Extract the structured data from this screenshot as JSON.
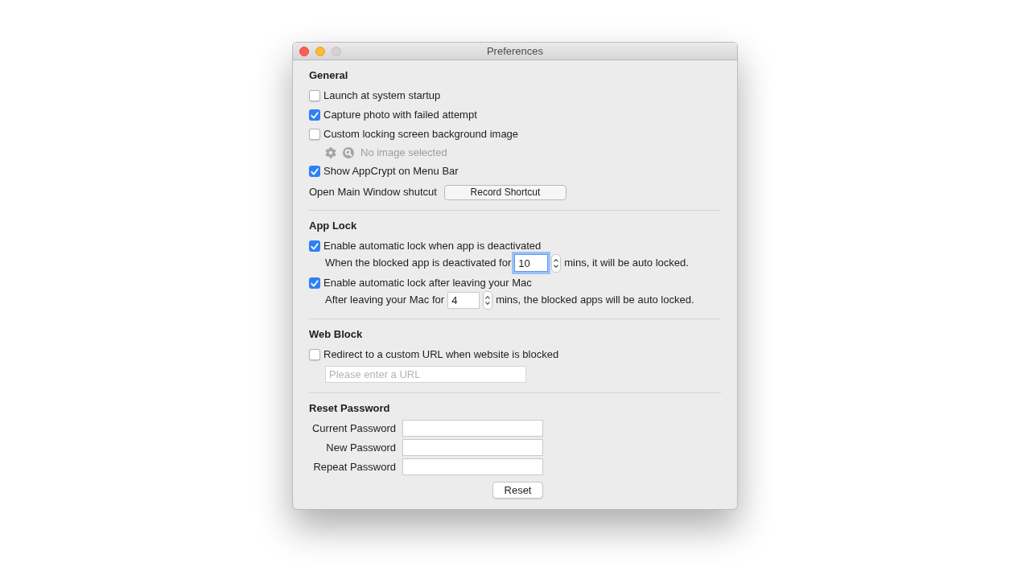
{
  "window": {
    "title": "Preferences",
    "zoom_disabled": true
  },
  "sections": [
    {
      "title": "General",
      "items": [
        {
          "kind": "checkbox",
          "label": "Launch at system startup",
          "checked": false
        },
        {
          "kind": "checkbox",
          "label": "Capture photo with failed attempt",
          "checked": true
        },
        {
          "kind": "checkbox",
          "label": "Custom locking screen background image",
          "checked": false
        },
        {
          "kind": "image_picker",
          "text": "No image selected",
          "disabled": true
        },
        {
          "kind": "checkbox",
          "label": "Show AppCrypt on Menu Bar",
          "checked": true
        },
        {
          "kind": "shortcut",
          "label": "Open Main Window shutcut",
          "button": "Record Shortcut"
        }
      ]
    },
    {
      "title": "App Lock",
      "items": [
        {
          "kind": "checkbox",
          "label": "Enable automatic lock when app is deactivated",
          "checked": true
        },
        {
          "kind": "stepper",
          "before": "When the blocked app is deactivated for",
          "value": "10",
          "after": "mins, it will be auto locked.",
          "focused": true
        },
        {
          "kind": "checkbox",
          "label": "Enable automatic lock after leaving your Mac",
          "checked": true
        },
        {
          "kind": "stepper",
          "before": "After leaving your Mac for",
          "value": "4",
          "after": "mins, the blocked apps will be auto locked.",
          "focused": false
        }
      ]
    },
    {
      "title": "Web Block",
      "items": [
        {
          "kind": "checkbox",
          "label": "Redirect to a custom URL when website is blocked",
          "checked": false
        },
        {
          "kind": "text_field",
          "placeholder": "Please enter a URL"
        }
      ]
    },
    {
      "title": "Reset Password",
      "items": [
        {
          "kind": "password",
          "label": "Current Password"
        },
        {
          "kind": "password",
          "label": "New Password"
        },
        {
          "kind": "password",
          "label": "Repeat Password"
        },
        {
          "kind": "button",
          "label": "Reset"
        }
      ]
    }
  ]
}
